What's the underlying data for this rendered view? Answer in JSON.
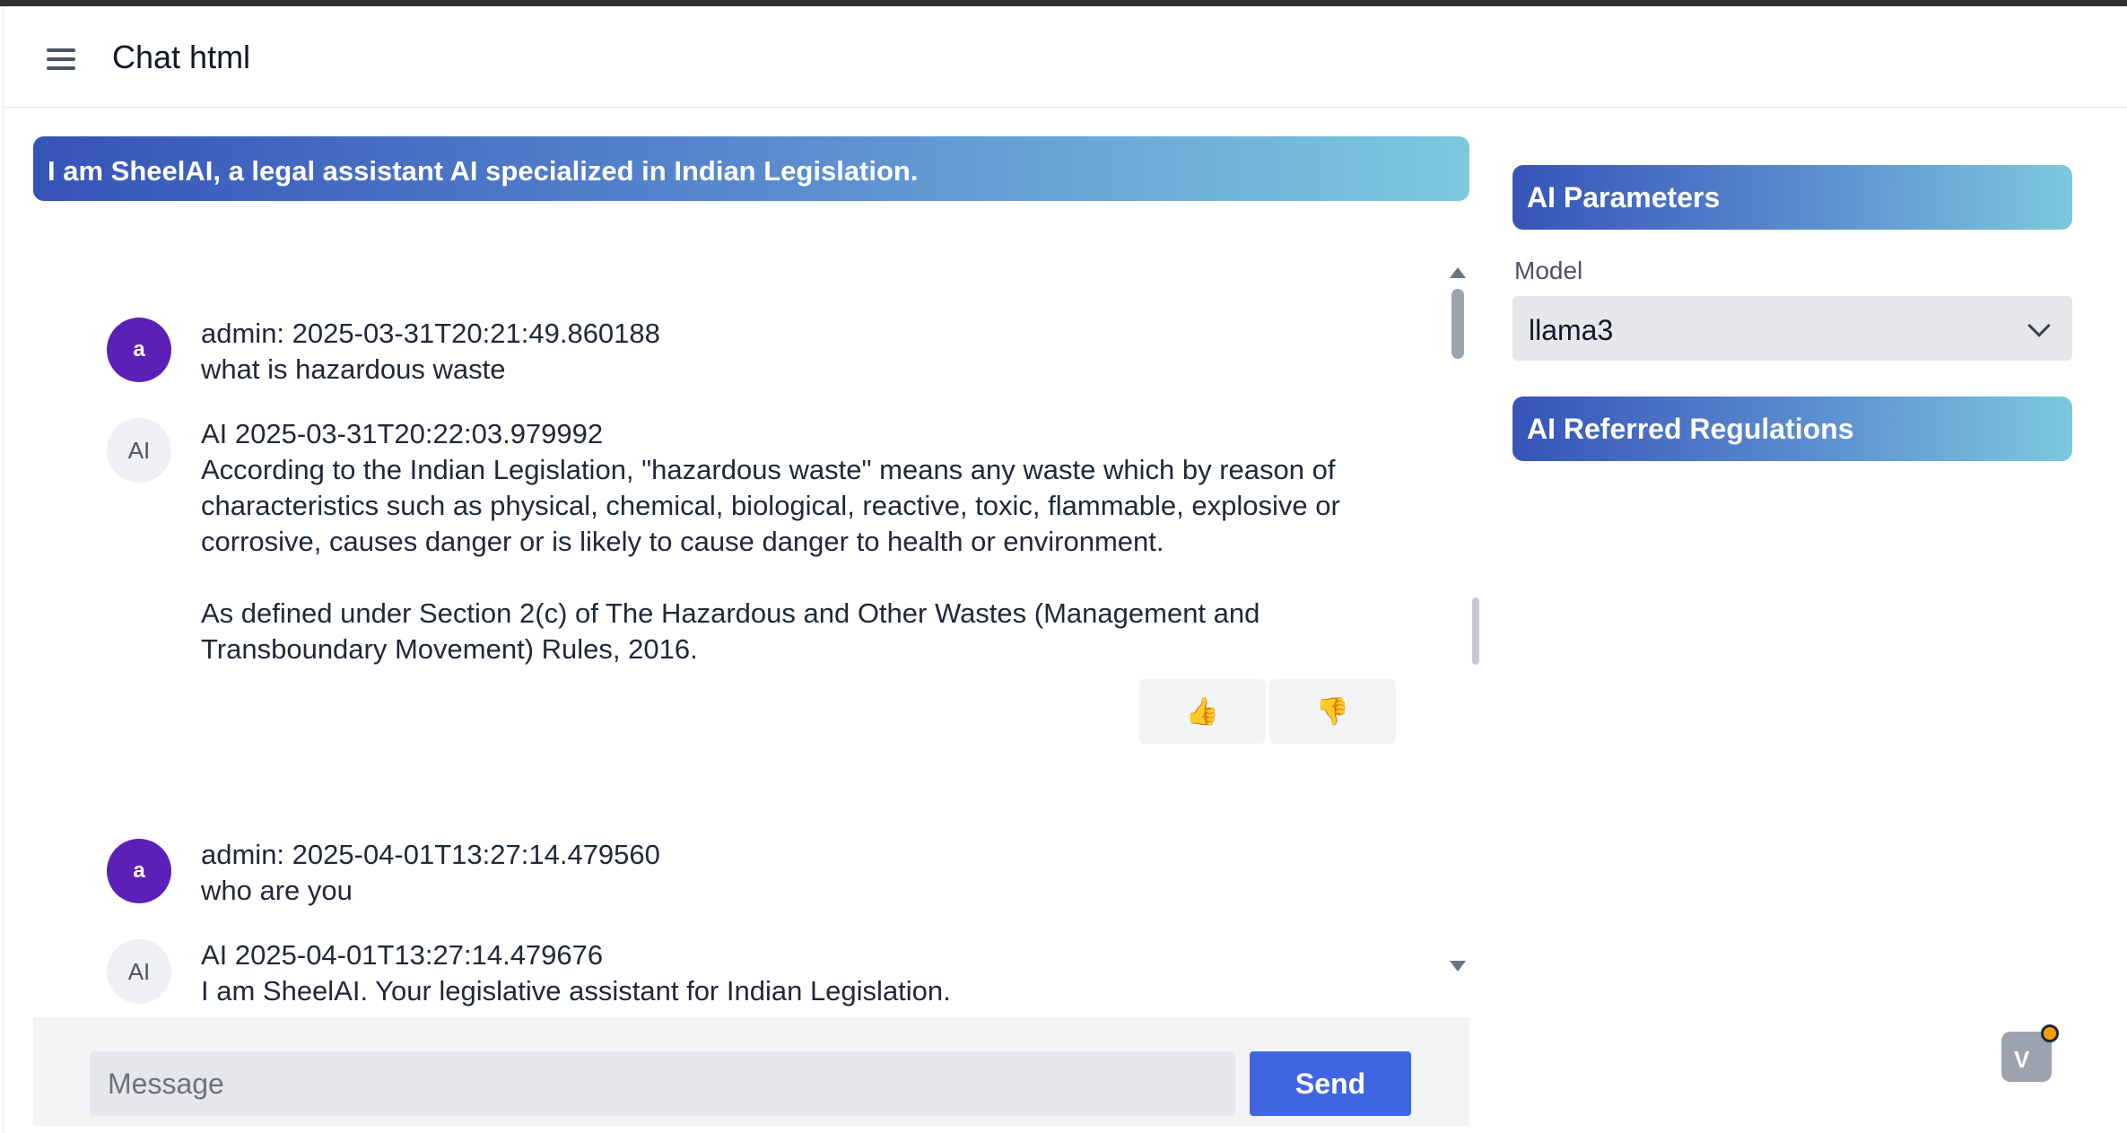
{
  "app": {
    "title": "Chat html"
  },
  "chat": {
    "banner": "I am SheelAI, a legal assistant AI specialized in Indian Legislation.",
    "messages": [
      {
        "role": "user",
        "avatar": "a",
        "meta": "admin: 2025-03-31T20:21:49.860188",
        "text": "what is hazardous waste"
      },
      {
        "role": "ai",
        "avatar": "AI",
        "meta": "AI 2025-03-31T20:22:03.979992",
        "text": "According to the Indian Legislation, \"hazardous waste\" means any waste which by reason of\ncharacteristics such as physical, chemical, biological, reactive, toxic, flammable, explosive or\ncorrosive, causes danger or is likely to cause danger to health or environment.\n\nAs defined under Section 2(c) of The Hazardous and Other Wastes (Management and\nTransboundary Movement) Rules, 2016."
      },
      {
        "role": "user",
        "avatar": "a",
        "meta": "admin: 2025-04-01T13:27:14.479560",
        "text": "who are you"
      },
      {
        "role": "ai",
        "avatar": "AI",
        "meta": "AI 2025-04-01T13:27:14.479676",
        "text": "I am SheelAI. Your legislative assistant for Indian Legislation."
      }
    ],
    "feedback": {
      "up": "👍",
      "down": "👎"
    }
  },
  "composer": {
    "placeholder": "Message",
    "value": "",
    "send_label": "Send"
  },
  "sidebar": {
    "params_title": "AI Parameters",
    "model_label": "Model",
    "model_value": "llama3",
    "regulations_title": "AI Referred Regulations"
  },
  "colors": {
    "accent": "#3f66e0",
    "user_avatar": "#5b21b6",
    "banner_start": "#3654b8",
    "banner_end": "#7cc9de"
  }
}
